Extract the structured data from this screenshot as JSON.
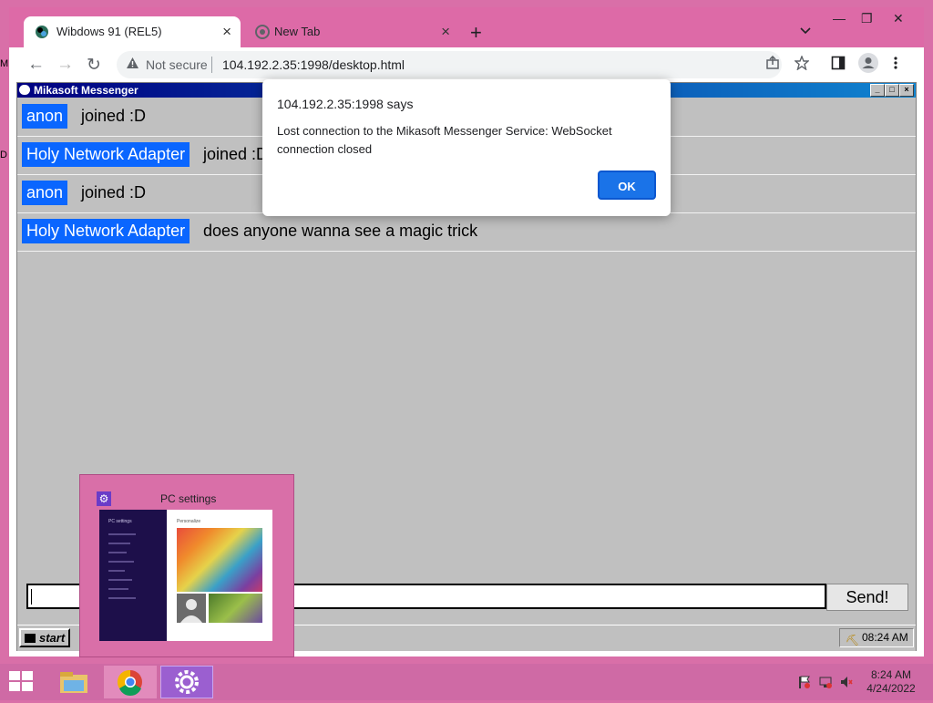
{
  "browser": {
    "tabs": [
      {
        "label": "Wibdows 91 (REL5)",
        "close": "×"
      },
      {
        "label": "New Tab",
        "close": "×"
      }
    ],
    "new_tab": "+",
    "tab_dropdown": "⌄",
    "window_controls": [
      "—",
      "❐",
      "✕"
    ],
    "nav": {
      "back": "←",
      "forward": "→",
      "reload": "↻"
    },
    "address": {
      "security_icon": "warning-triangle-icon",
      "security_label": "Not secure",
      "url": "104.192.2.35:1998/desktop.html"
    },
    "toolbar_icons": [
      "share-icon",
      "star-icon",
      "sidepanel-icon",
      "profile-icon",
      "menu-icon"
    ]
  },
  "messenger": {
    "title": "Mikasoft Messenger",
    "window_buttons": [
      "_",
      "□",
      "×"
    ],
    "messages": [
      {
        "user": "anon",
        "text": "joined :D"
      },
      {
        "user": "Holy Network Adapter",
        "text": "joined :D"
      },
      {
        "user": "anon",
        "text": "joined :D"
      },
      {
        "user": "Holy Network Adapter",
        "text": "does anyone wanna see a magic trick"
      }
    ],
    "input_value": "",
    "send_label": "Send!",
    "start_label": "start",
    "tray_time": "08:24 AM",
    "edge_letters": [
      "M",
      "D"
    ]
  },
  "dialog": {
    "title": "104.192.2.35:1998 says",
    "message": "Lost connection to the Mikasoft Messenger Service: WebSocket connection closed",
    "ok_label": "OK"
  },
  "thumbnail": {
    "title": "PC settings",
    "preview_heading": "PC settings",
    "preview_subheading": "Personalize"
  },
  "taskbar": {
    "clock_time": "8:24 AM",
    "clock_date": "4/24/2022"
  },
  "colors": {
    "desktop": "#d96fa8",
    "username_badge": "#0a66ff",
    "dialog_button": "#1a73e8"
  }
}
